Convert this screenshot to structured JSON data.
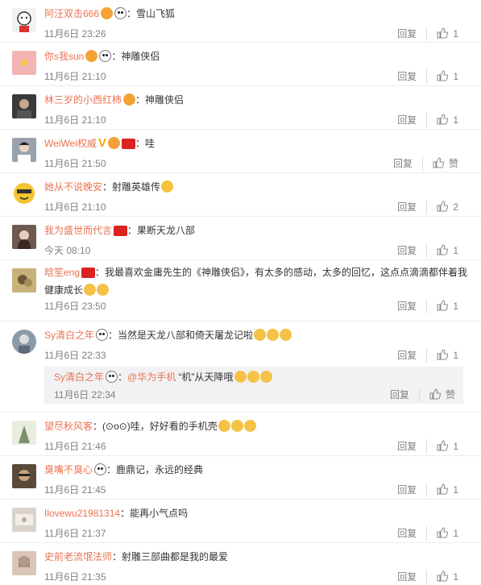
{
  "comments": [
    {
      "user": "阿汪双击666",
      "text": "雪山飞狐",
      "time": "11月6日 23:26",
      "reply": "回复",
      "likes": "1",
      "avatar_color": "#f2f2f2"
    },
    {
      "user": "你s我sun",
      "text": "神雕侠侣",
      "time": "11月6日 21:10",
      "reply": "回复",
      "likes": "1",
      "avatar_color": "#f3b4b4"
    },
    {
      "user": "林三岁的小西红柿",
      "text": "神雕侠侣",
      "time": "11月6日 21:10",
      "reply": "回复",
      "likes": "1",
      "avatar_color": "#3a3a3a"
    },
    {
      "user": "WeiWei权威",
      "text": "哇",
      "time": "11月6日 21:50",
      "reply": "回复",
      "likes": "赞",
      "avatar_color": "#9aa3ad"
    },
    {
      "user": "她从不说晚安",
      "text": "射雕英雄传",
      "time": "11月6日 21:10",
      "reply": "回复",
      "likes": "2",
      "avatar_color": "#f3c52e"
    },
    {
      "user": "我为盛世而代言",
      "text": "果断天龙八部",
      "time": "今天 08:10",
      "reply": "回复",
      "likes": "1",
      "avatar_color": "#6d5a52"
    },
    {
      "user": "晗笙eng",
      "text": "我最喜欢金庸先生的《神雕侠侣》，有太多的感动，太多的回忆，这点点滴滴都伴着我健康成长",
      "time": "11月6日 23:50",
      "reply": "回复",
      "likes": "1",
      "avatar_color": "#c7b27a"
    },
    {
      "user": "Sy清白之年",
      "text": "当然是天龙八部和倚天屠龙记啦",
      "time": "11月6日 22:33",
      "reply": "回复",
      "likes": "1",
      "avatar_color": "#8b9aa8",
      "sub": {
        "user": "Sy清白之年",
        "mention": "@华为手机",
        "text": "“机”从天降哦",
        "time": "11月6日 22:34",
        "reply": "回复",
        "likes": "赞"
      }
    },
    {
      "user": "望尽秋风客",
      "text": "(⊙o⊙)哇，好好看的手机壳",
      "time": "11月6日 21:46",
      "reply": "回复",
      "likes": "1",
      "avatar_color": "#b8c6a8"
    },
    {
      "user": "臭嘴不臭心",
      "text": "鹿鼎记，永远的经典",
      "time": "11月6日 21:45",
      "reply": "回复",
      "likes": "1",
      "avatar_color": "#5a4a3a"
    },
    {
      "user": "Ilovewu21981314",
      "text": "能再小气点吗",
      "time": "11月6日 21:37",
      "reply": "回复",
      "likes": "1",
      "avatar_color": "#d9d3cc"
    },
    {
      "user": "史前老流氓法师",
      "text": "射雕三部曲都是我的最爱",
      "time": "11月6日 21:35",
      "reply": "回复",
      "likes": "1",
      "avatar_color": "#d9c6b8"
    }
  ]
}
